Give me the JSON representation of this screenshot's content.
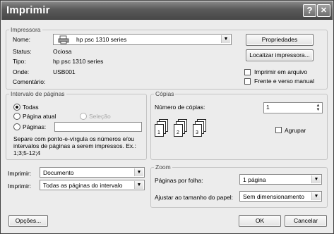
{
  "window": {
    "title": "Imprimir",
    "help_glyph": "?",
    "close_glyph": "✕"
  },
  "printer": {
    "group_label": "Impressora",
    "name_label": "Nome:",
    "name_value": "hp psc 1310 series",
    "properties_button": "Propriedades",
    "find_printer_button": "Localizar impressora...",
    "status_label": "Status:",
    "status_value": "Ociosa",
    "type_label": "Tipo:",
    "type_value": "hp psc 1310 series",
    "where_label": "Onde:",
    "where_value": "USB001",
    "comment_label": "Comentário:",
    "print_to_file": {
      "label": "Imprimir em arquivo",
      "checked": false
    },
    "duplex": {
      "label": "Frente e verso manual",
      "checked": false
    }
  },
  "page_range": {
    "group_label": "Intervalo de páginas",
    "all": {
      "label": "Todas",
      "selected": true
    },
    "current": {
      "label": "Página atual",
      "selected": false
    },
    "selection": {
      "label": "Seleção",
      "enabled": false
    },
    "pages": {
      "label": "Páginas:",
      "value": ""
    },
    "hint": [
      "Separe com ponto-e-vírgula os números e/ou",
      "intervalos de páginas a serem impressos.  Ex.:",
      "1;3;5-12;4"
    ]
  },
  "print_what": {
    "label": "Imprimir:",
    "value": "Documento"
  },
  "print_pages": {
    "label": "Imprimir:",
    "value": "Todas as páginas do intervalo"
  },
  "copies": {
    "group_label": "Cópias",
    "count_label": "Número de cópias:",
    "count_value": "1",
    "collate": {
      "label": "Agrupar",
      "checked": false
    },
    "pages_shown": [
      "1",
      "2",
      "3"
    ]
  },
  "zoom": {
    "group_label": "Zoom",
    "pages_per_sheet_label": "Páginas por folha:",
    "pages_per_sheet_value": "1 página",
    "scale_label": "Ajustar ao tamanho do papel:",
    "scale_value": "Sem dimensionamento"
  },
  "footer": {
    "options_button": "Opções...",
    "ok_button": "OK",
    "cancel_button": "Cancelar"
  }
}
